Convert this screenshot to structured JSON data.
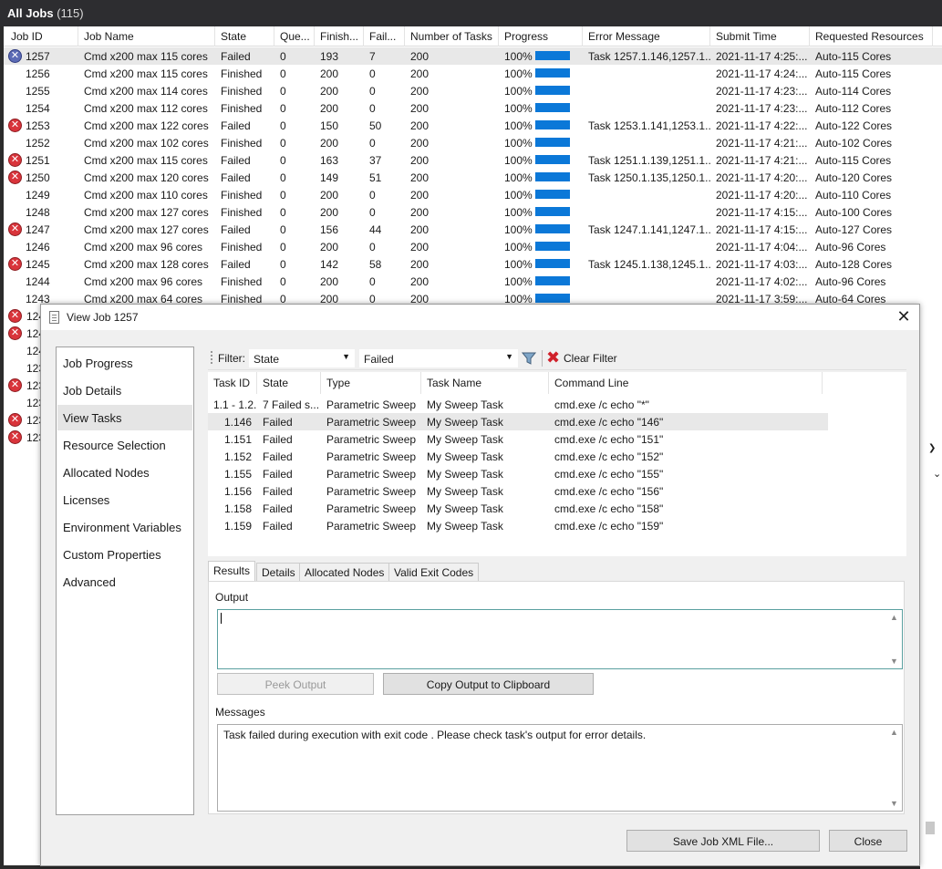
{
  "window": {
    "title": "All Jobs",
    "count": "(115)"
  },
  "jobs_grid": {
    "columns": [
      "Job ID",
      "Job Name",
      "State",
      "Que...",
      "Finish...",
      "Fail...",
      "Number of Tasks",
      "Progress",
      "Error Message",
      "Submit Time",
      "Requested Resources"
    ],
    "rows": [
      {
        "id": "1257",
        "name": "Cmd x200 max 115 cores",
        "state": "Failed",
        "queued": "0",
        "finished": "193",
        "failed": "7",
        "tasks": "200",
        "progress": "100%",
        "error": "Task 1257.1.146,1257.1....",
        "submit": "2021-11-17 4:25:...",
        "resources": "Auto-115 Cores",
        "icon": true,
        "selected": true
      },
      {
        "id": "1256",
        "name": "Cmd x200 max 115 cores",
        "state": "Finished",
        "queued": "0",
        "finished": "200",
        "failed": "0",
        "tasks": "200",
        "progress": "100%",
        "error": "",
        "submit": "2021-11-17 4:24:...",
        "resources": "Auto-115 Cores",
        "icon": false
      },
      {
        "id": "1255",
        "name": "Cmd x200 max 114 cores",
        "state": "Finished",
        "queued": "0",
        "finished": "200",
        "failed": "0",
        "tasks": "200",
        "progress": "100%",
        "error": "",
        "submit": "2021-11-17 4:23:...",
        "resources": "Auto-114 Cores",
        "icon": false
      },
      {
        "id": "1254",
        "name": "Cmd x200 max 112 cores",
        "state": "Finished",
        "queued": "0",
        "finished": "200",
        "failed": "0",
        "tasks": "200",
        "progress": "100%",
        "error": "",
        "submit": "2021-11-17 4:23:...",
        "resources": "Auto-112 Cores",
        "icon": false
      },
      {
        "id": "1253",
        "name": "Cmd x200 max 122 cores",
        "state": "Failed",
        "queued": "0",
        "finished": "150",
        "failed": "50",
        "tasks": "200",
        "progress": "100%",
        "error": "Task 1253.1.141,1253.1....",
        "submit": "2021-11-17 4:22:...",
        "resources": "Auto-122 Cores",
        "icon": true
      },
      {
        "id": "1252",
        "name": "Cmd x200 max 102 cores",
        "state": "Finished",
        "queued": "0",
        "finished": "200",
        "failed": "0",
        "tasks": "200",
        "progress": "100%",
        "error": "",
        "submit": "2021-11-17 4:21:...",
        "resources": "Auto-102 Cores",
        "icon": false
      },
      {
        "id": "1251",
        "name": "Cmd x200 max 115 cores",
        "state": "Failed",
        "queued": "0",
        "finished": "163",
        "failed": "37",
        "tasks": "200",
        "progress": "100%",
        "error": "Task 1251.1.139,1251.1....",
        "submit": "2021-11-17 4:21:...",
        "resources": "Auto-115 Cores",
        "icon": true
      },
      {
        "id": "1250",
        "name": "Cmd x200 max 120 cores",
        "state": "Failed",
        "queued": "0",
        "finished": "149",
        "failed": "51",
        "tasks": "200",
        "progress": "100%",
        "error": "Task 1250.1.135,1250.1....",
        "submit": "2021-11-17 4:20:...",
        "resources": "Auto-120 Cores",
        "icon": true
      },
      {
        "id": "1249",
        "name": "Cmd x200 max 110 cores",
        "state": "Finished",
        "queued": "0",
        "finished": "200",
        "failed": "0",
        "tasks": "200",
        "progress": "100%",
        "error": "",
        "submit": "2021-11-17 4:20:...",
        "resources": "Auto-110 Cores",
        "icon": false
      },
      {
        "id": "1248",
        "name": "Cmd x200 max 127 cores",
        "state": "Finished",
        "queued": "0",
        "finished": "200",
        "failed": "0",
        "tasks": "200",
        "progress": "100%",
        "error": "",
        "submit": "2021-11-17 4:15:...",
        "resources": "Auto-100 Cores",
        "icon": false
      },
      {
        "id": "1247",
        "name": "Cmd x200 max 127 cores",
        "state": "Failed",
        "queued": "0",
        "finished": "156",
        "failed": "44",
        "tasks": "200",
        "progress": "100%",
        "error": "Task 1247.1.141,1247.1....",
        "submit": "2021-11-17 4:15:...",
        "resources": "Auto-127 Cores",
        "icon": true
      },
      {
        "id": "1246",
        "name": "Cmd x200 max 96 cores",
        "state": "Finished",
        "queued": "0",
        "finished": "200",
        "failed": "0",
        "tasks": "200",
        "progress": "100%",
        "error": "",
        "submit": "2021-11-17 4:04:...",
        "resources": "Auto-96 Cores",
        "icon": false
      },
      {
        "id": "1245",
        "name": "Cmd x200 max 128 cores",
        "state": "Failed",
        "queued": "0",
        "finished": "142",
        "failed": "58",
        "tasks": "200",
        "progress": "100%",
        "error": "Task 1245.1.138,1245.1....",
        "submit": "2021-11-17 4:03:...",
        "resources": "Auto-128 Cores",
        "icon": true
      },
      {
        "id": "1244",
        "name": "Cmd x200 max 96 cores",
        "state": "Finished",
        "queued": "0",
        "finished": "200",
        "failed": "0",
        "tasks": "200",
        "progress": "100%",
        "error": "",
        "submit": "2021-11-17 4:02:...",
        "resources": "Auto-96 Cores",
        "icon": false
      },
      {
        "id": "1243",
        "name": "Cmd x200 max 64 cores",
        "state": "Finished",
        "queued": "0",
        "finished": "200",
        "failed": "0",
        "tasks": "200",
        "progress": "100%",
        "error": "",
        "submit": "2021-11-17 3:59:...",
        "resources": "Auto-64 Cores",
        "icon": false
      }
    ],
    "hidden_row_stubs": [
      {
        "id": "124",
        "icon": true
      },
      {
        "id": "124",
        "icon": true
      },
      {
        "id": "124",
        "icon": false
      },
      {
        "id": "123",
        "icon": false
      },
      {
        "id": "123",
        "icon": true
      },
      {
        "id": "123",
        "icon": false
      },
      {
        "id": "123",
        "icon": true
      },
      {
        "id": "123",
        "icon": true
      }
    ]
  },
  "dialog": {
    "title": "View Job 1257",
    "nav": [
      "Job Progress",
      "Job Details",
      "View Tasks",
      "Resource Selection",
      "Allocated Nodes",
      "Licenses",
      "Environment Variables",
      "Custom Properties",
      "Advanced"
    ],
    "nav_active": "View Tasks",
    "filter": {
      "label": "Filter:",
      "field": "State",
      "value": "Failed",
      "clear_label": "Clear Filter"
    },
    "tasks": {
      "columns": [
        "Task ID",
        "State",
        "Type",
        "Task Name",
        "Command Line"
      ],
      "rows": [
        {
          "id": "1.1 - 1.2...",
          "state": "7 Failed s...",
          "type": "Parametric Sweep",
          "name": "My Sweep Task",
          "cmd": "cmd.exe /c echo \"*\""
        },
        {
          "id": "1.146",
          "state": "Failed",
          "type": "Parametric Sweep",
          "name": "My Sweep Task",
          "cmd": "cmd.exe /c echo \"146\"",
          "selected": true
        },
        {
          "id": "1.151",
          "state": "Failed",
          "type": "Parametric Sweep",
          "name": "My Sweep Task",
          "cmd": "cmd.exe /c echo \"151\""
        },
        {
          "id": "1.152",
          "state": "Failed",
          "type": "Parametric Sweep",
          "name": "My Sweep Task",
          "cmd": "cmd.exe /c echo \"152\""
        },
        {
          "id": "1.155",
          "state": "Failed",
          "type": "Parametric Sweep",
          "name": "My Sweep Task",
          "cmd": "cmd.exe /c echo \"155\""
        },
        {
          "id": "1.156",
          "state": "Failed",
          "type": "Parametric Sweep",
          "name": "My Sweep Task",
          "cmd": "cmd.exe /c echo \"156\""
        },
        {
          "id": "1.158",
          "state": "Failed",
          "type": "Parametric Sweep",
          "name": "My Sweep Task",
          "cmd": "cmd.exe /c echo \"158\""
        },
        {
          "id": "1.159",
          "state": "Failed",
          "type": "Parametric Sweep",
          "name": "My Sweep Task",
          "cmd": "cmd.exe /c echo \"159\""
        }
      ]
    },
    "detail_tabs": [
      "Results",
      "Details",
      "Allocated Nodes",
      "Valid Exit Codes"
    ],
    "detail_tab_active": "Results",
    "output_label": "Output",
    "output_value": "",
    "peek_button": "Peek Output",
    "copy_button": "Copy Output to Clipboard",
    "messages_label": "Messages",
    "messages_text": "Task failed during execution with exit code . Please check task's output for error details.",
    "save_button": "Save Job XML File...",
    "close_button": "Close"
  },
  "colors": {
    "progress_fill": "#0b78d8",
    "error_icon": "#d9343b",
    "title_bar": "#2d2d30"
  }
}
